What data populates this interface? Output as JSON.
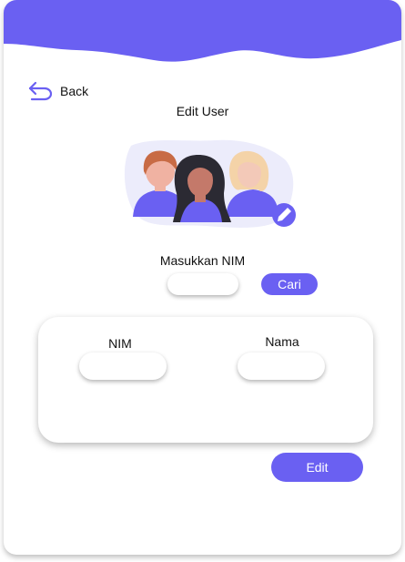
{
  "header": {
    "back_label": "Back",
    "title": "Edit User"
  },
  "search": {
    "label": "Masukkan NIM",
    "input_value": "",
    "button_label": "Cari"
  },
  "form": {
    "nim_label": "NIM",
    "nim_value": "",
    "nama_label": "Nama",
    "nama_value": ""
  },
  "actions": {
    "edit_label": "Edit"
  },
  "colors": {
    "accent": "#6a60f2",
    "background": "#ffffff"
  },
  "icons": {
    "back": "back-arrow-icon",
    "edit_avatar": "pencil-icon"
  }
}
